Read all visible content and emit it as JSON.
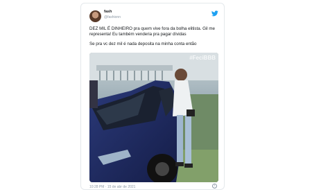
{
  "tweet": {
    "display_name": "fash",
    "handle": "@fashionn",
    "paragraphs": [
      "DEZ MIL É DINHEIRO pra quem vive fora da bolha elitista. Gil me representa! Eu também venderia pra pagar dívidas",
      "Se pra vc dez mil é nada deposita na minha conta então"
    ],
    "media_watermark": "#FeciBBB",
    "timestamp": "10:28 PM · 15 de abr de 2021",
    "info_icon_glyph": "i"
  },
  "icons": {
    "platform": "twitter-bird-icon",
    "info": "info-icon"
  },
  "colors": {
    "accent": "#1da1f2",
    "muted": "#8b98a5",
    "text": "#14171a",
    "car": "#1e2a5e"
  }
}
